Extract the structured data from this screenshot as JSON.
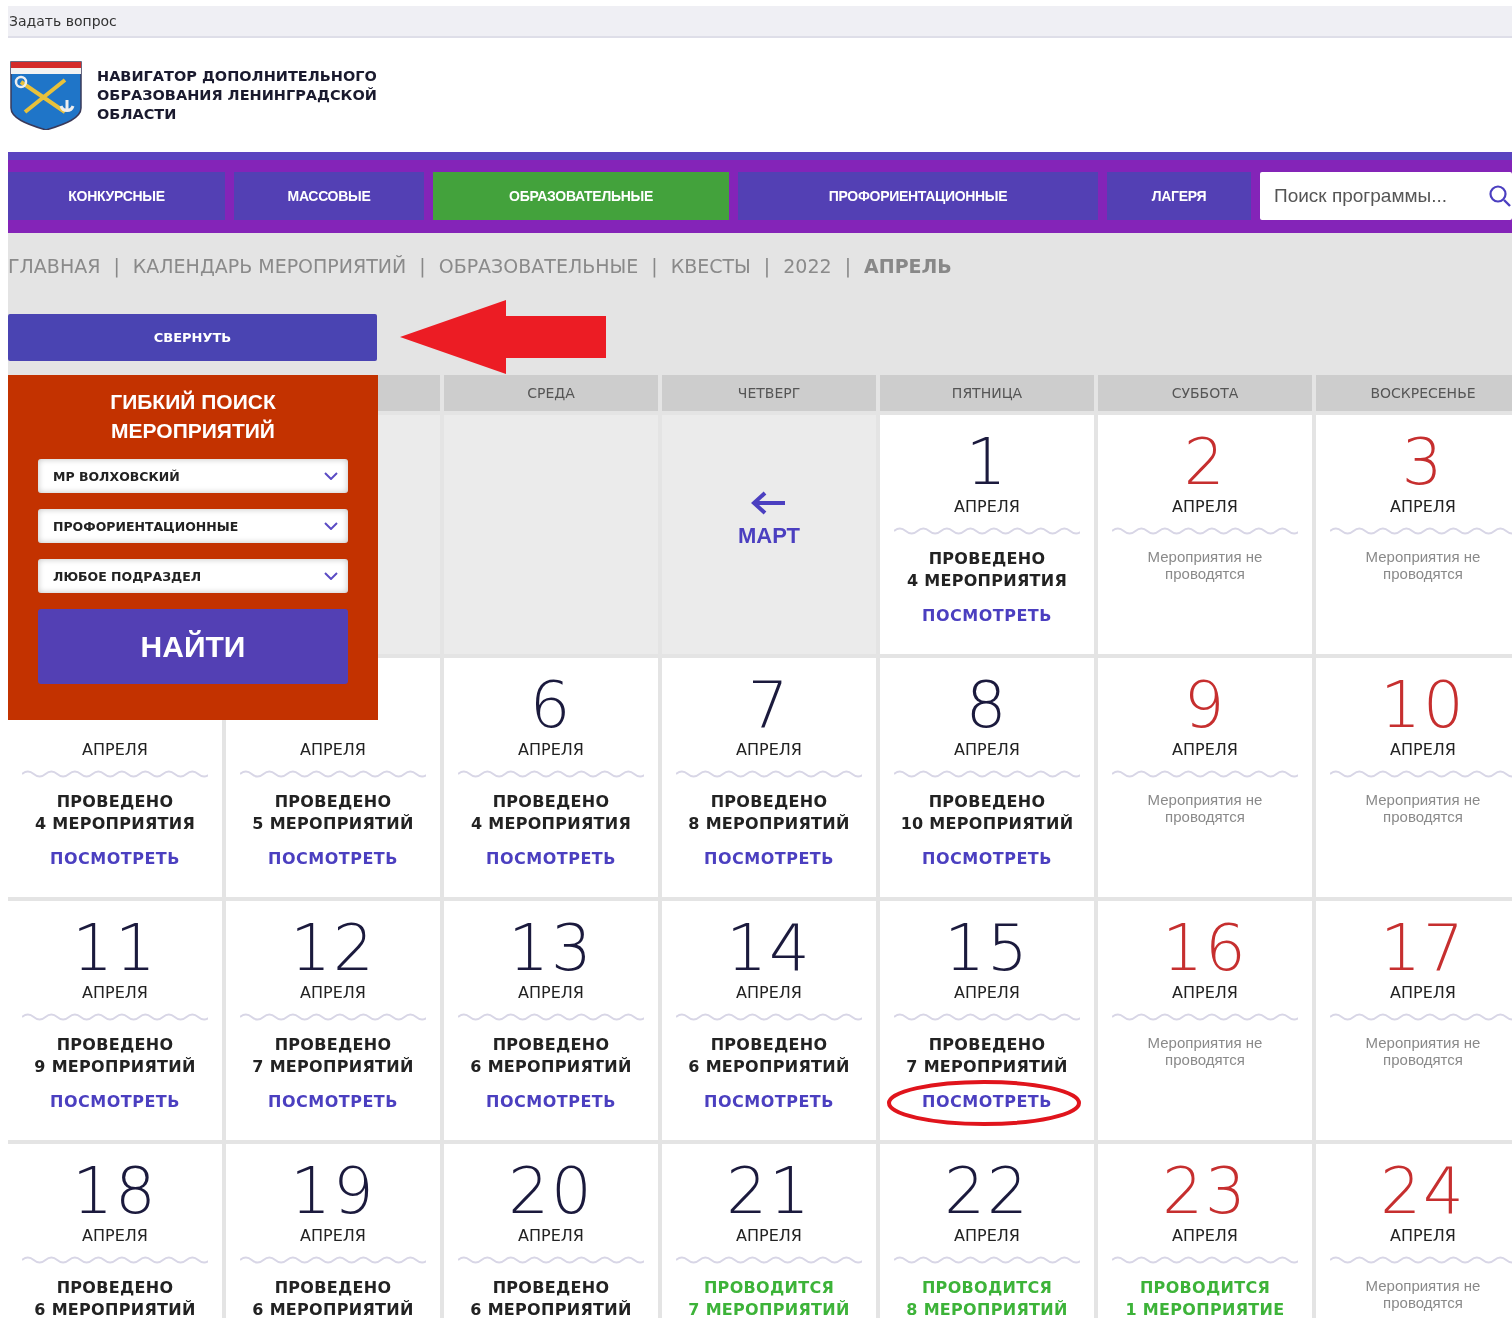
{
  "top_bar": {
    "link": "Задать вопрос"
  },
  "header": {
    "title_lines": [
      "НАВИГАТОР ДОПОЛНИТЕЛЬНОГО",
      "ОБРАЗОВАНИЯ ЛЕНИНГРАДСКОЙ",
      "ОБЛАСТИ"
    ]
  },
  "tabs": [
    {
      "label": "КОНКУРСНЫЕ",
      "selected": false
    },
    {
      "label": "МАССОВЫЕ",
      "selected": false
    },
    {
      "label": "ОБРАЗОВАТЕЛЬНЫЕ",
      "selected": true
    },
    {
      "label": "ПРОФОРИЕНТАЦИОННЫЕ",
      "selected": false
    },
    {
      "label": "ЛАГЕРЯ",
      "selected": false
    }
  ],
  "search": {
    "placeholder": "Поиск программы..."
  },
  "breadcrumb": {
    "separator": "|",
    "items": [
      {
        "label": "ГЛАВНАЯ",
        "current": false
      },
      {
        "label": "КАЛЕНДАРЬ МЕРОПРИЯТИЙ",
        "current": false
      },
      {
        "label": "ОБРАЗОВАТЕЛЬНЫЕ",
        "current": false
      },
      {
        "label": "КВЕСТЫ",
        "current": false
      },
      {
        "label": "2022",
        "current": false
      },
      {
        "label": "АПРЕЛЬ",
        "current": true
      }
    ]
  },
  "collapse_button": "СВЕРНУТЬ",
  "filter_panel": {
    "title": "ГИБКИЙ ПОИСК МЕРОПРИЯТИЙ",
    "selects": [
      "МР ВОЛХОВСКИЙ",
      "ПРОФОРИЕНТАЦИОННЫЕ",
      "ЛЮБОЕ ПОДРАЗДЕЛ"
    ],
    "button": "НАЙТИ"
  },
  "weekdays": [
    "СРЕДА",
    "ЧЕТВЕРГ",
    "ПЯТНИЦА",
    "СУББОТА",
    "ВОСКРЕСЕНЬЕ"
  ],
  "cells": [
    {
      "kind": "empty"
    },
    {
      "kind": "empty"
    },
    {
      "kind": "empty"
    },
    {
      "kind": "prev",
      "label": "МАРТ"
    },
    {
      "kind": "done",
      "day": "1",
      "weekend": false,
      "month": "АПРЕЛЯ",
      "status": "ПРОВЕДЕНО",
      "count": "4 МЕРОПРИЯТИЯ",
      "link": "ПОСМОТРЕТЬ"
    },
    {
      "kind": "none",
      "day": "2",
      "weekend": true,
      "month": "АПРЕЛЯ",
      "note": "Мероприятия не проводятся"
    },
    {
      "kind": "none",
      "day": "3",
      "weekend": true,
      "month": "АПРЕЛЯ",
      "note": "Мероприятия не проводятся"
    },
    {
      "kind": "done",
      "month": "АПРЕЛЯ",
      "status": "ПРОВЕДЕНО",
      "count": "4 МЕРОПРИЯТИЯ",
      "link": "ПОСМОТРЕТЬ"
    },
    {
      "kind": "done",
      "month": "АПРЕЛЯ",
      "status": "ПРОВЕДЕНО",
      "count": "5 МЕРОПРИЯТИЙ",
      "link": "ПОСМОТРЕТЬ"
    },
    {
      "kind": "done",
      "day": "6",
      "weekend": false,
      "month": "АПРЕЛЯ",
      "status": "ПРОВЕДЕНО",
      "count": "4 МЕРОПРИЯТИЯ",
      "link": "ПОСМОТРЕТЬ"
    },
    {
      "kind": "done",
      "day": "7",
      "weekend": false,
      "month": "АПРЕЛЯ",
      "status": "ПРОВЕДЕНО",
      "count": "8 МЕРОПРИЯТИЙ",
      "link": "ПОСМОТРЕТЬ"
    },
    {
      "kind": "done",
      "day": "8",
      "weekend": false,
      "month": "АПРЕЛЯ",
      "status": "ПРОВЕДЕНО",
      "count": "10 МЕРОПРИЯТИЙ",
      "link": "ПОСМОТРЕТЬ"
    },
    {
      "kind": "none",
      "day": "9",
      "weekend": true,
      "month": "АПРЕЛЯ",
      "note": "Мероприятия не проводятся"
    },
    {
      "kind": "none",
      "day": "10",
      "weekend": true,
      "month": "АПРЕЛЯ",
      "note": "Мероприятия не проводятся"
    },
    {
      "kind": "done",
      "day": "11",
      "weekend": false,
      "month": "АПРЕЛЯ",
      "status": "ПРОВЕДЕНО",
      "count": "9 МЕРОПРИЯТИЙ",
      "link": "ПОСМОТРЕТЬ"
    },
    {
      "kind": "done",
      "day": "12",
      "weekend": false,
      "month": "АПРЕЛЯ",
      "status": "ПРОВЕДЕНО",
      "count": "7 МЕРОПРИЯТИЙ",
      "link": "ПОСМОТРЕТЬ"
    },
    {
      "kind": "done",
      "day": "13",
      "weekend": false,
      "month": "АПРЕЛЯ",
      "status": "ПРОВЕДЕНО",
      "count": "6 МЕРОПРИЯТИЙ",
      "link": "ПОСМОТРЕТЬ"
    },
    {
      "kind": "done",
      "day": "14",
      "weekend": false,
      "month": "АПРЕЛЯ",
      "status": "ПРОВЕДЕНО",
      "count": "6 МЕРОПРИЯТИЙ",
      "link": "ПОСМОТРЕТЬ"
    },
    {
      "kind": "done",
      "day": "15",
      "weekend": false,
      "month": "АПРЕЛЯ",
      "status": "ПРОВЕДЕНО",
      "count": "7 МЕРОПРИЯТИЙ",
      "link": "ПОСМОТРЕТЬ",
      "circled": true
    },
    {
      "kind": "none",
      "day": "16",
      "weekend": true,
      "month": "АПРЕЛЯ",
      "note": "Мероприятия не проводятся"
    },
    {
      "kind": "none",
      "day": "17",
      "weekend": true,
      "month": "АПРЕЛЯ",
      "note": "Мероприятия не проводятся"
    },
    {
      "kind": "done",
      "day": "18",
      "weekend": false,
      "month": "АПРЕЛЯ",
      "status": "ПРОВЕДЕНО",
      "count": "6 МЕРОПРИЯТИЙ"
    },
    {
      "kind": "done",
      "day": "19",
      "weekend": false,
      "month": "АПРЕЛЯ",
      "status": "ПРОВЕДЕНО",
      "count": "6 МЕРОПРИЯТИЙ"
    },
    {
      "kind": "done",
      "day": "20",
      "weekend": false,
      "month": "АПРЕЛЯ",
      "status": "ПРОВЕДЕНО",
      "count": "6 МЕРОПРИЯТИЙ"
    },
    {
      "kind": "ongoing",
      "day": "21",
      "weekend": false,
      "month": "АПРЕЛЯ",
      "status": "ПРОВОДИТСЯ",
      "count": "7 МЕРОПРИЯТИЙ"
    },
    {
      "kind": "ongoing",
      "day": "22",
      "weekend": false,
      "month": "АПРЕЛЯ",
      "status": "ПРОВОДИТСЯ",
      "count": "8 МЕРОПРИЯТИЙ"
    },
    {
      "kind": "ongoing",
      "day": "23",
      "weekend": true,
      "month": "АПРЕЛЯ",
      "status": "ПРОВОДИТСЯ",
      "count": "1 МЕРОПРИЯТИЕ"
    },
    {
      "kind": "none",
      "day": "24",
      "weekend": true,
      "month": "АПРЕЛЯ",
      "note": "Мероприятия не проводятся"
    }
  ]
}
